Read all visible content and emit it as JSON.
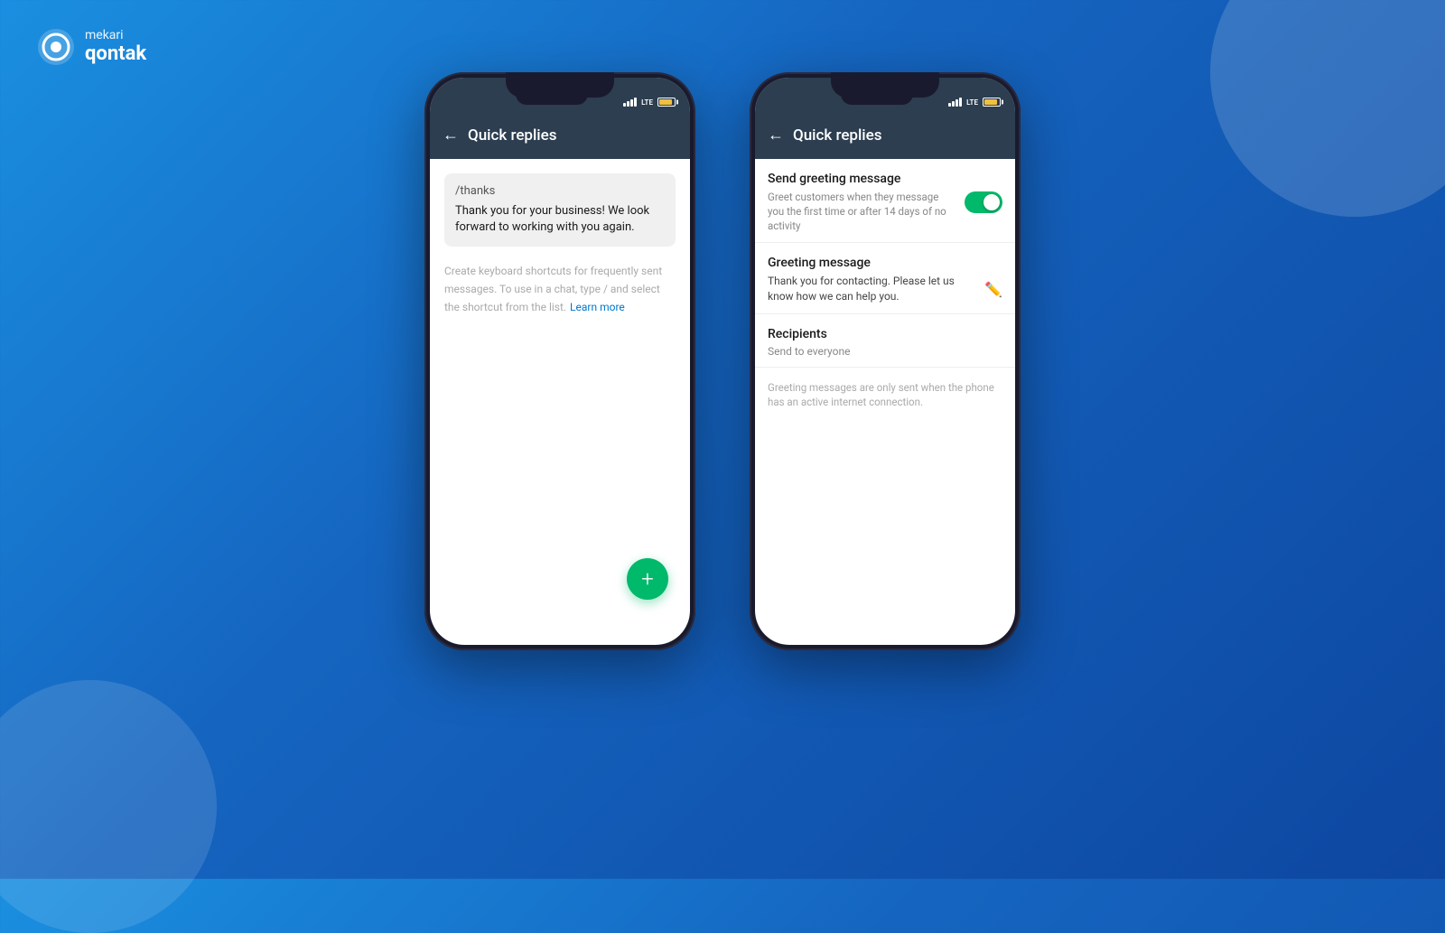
{
  "app": {
    "name": "mekari",
    "brand": "qontak"
  },
  "background": {
    "circle_top_right": true,
    "circle_bottom_left": true
  },
  "phone1": {
    "status_bar": {
      "signal": "lll",
      "lte": "LTE",
      "battery_level": "70"
    },
    "header": {
      "back_label": "←",
      "title": "Quick replies"
    },
    "quick_reply": {
      "shortcut": "/thanks",
      "message": "Thank you for your business! We look forward to working with you again."
    },
    "helper": {
      "text": "Create keyboard shortcuts for frequently sent messages. To use in a chat, type / and select the shortcut from the list.",
      "learn_more_label": "Learn more"
    },
    "fab": {
      "label": "+"
    }
  },
  "phone2": {
    "status_bar": {
      "signal": "lll",
      "lte": "LTE",
      "battery_level": "70"
    },
    "header": {
      "back_label": "←",
      "title": "Quick replies"
    },
    "greeting_toggle": {
      "label": "Send greeting message",
      "description": "Greet customers when they message you the first time or after 14 days of no activity",
      "enabled": true
    },
    "greeting_message": {
      "label": "Greeting message",
      "text": "Thank you for contacting. Please let us know how we can help you."
    },
    "recipients": {
      "label": "Recipients",
      "value": "Send to everyone"
    },
    "note": "Greeting messages are only sent when the phone has an active internet connection."
  }
}
